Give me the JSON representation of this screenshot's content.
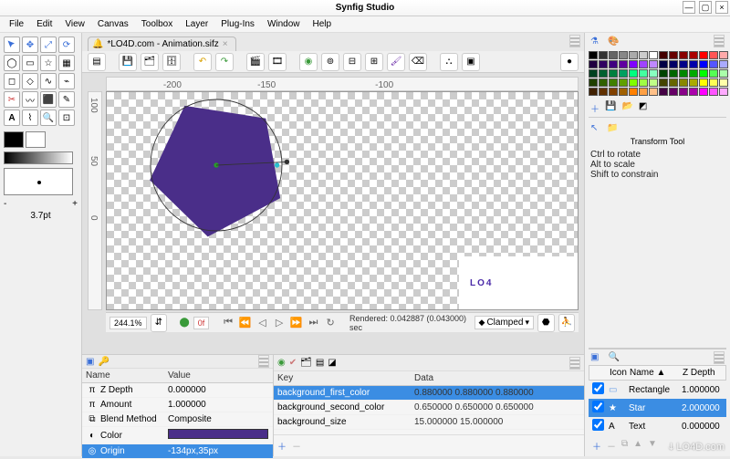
{
  "window": {
    "title": "Synfig Studio"
  },
  "menu": [
    "File",
    "Edit",
    "View",
    "Canvas",
    "Toolbox",
    "Layer",
    "Plug-Ins",
    "Window",
    "Help"
  ],
  "tab": {
    "label": "*LO4D.com - Animation.sifz"
  },
  "toolbox": {
    "stroke_adjust_minus": "-",
    "stroke_adjust_plus": "+",
    "stroke_pt": "3.7pt"
  },
  "ruler_h": {
    "m200": "-200",
    "m150": "-150",
    "m100": "-100"
  },
  "ruler_v": {
    "v100": "100",
    "v50": "50",
    "v0": "0"
  },
  "zoom": {
    "value": "244.1%"
  },
  "frame": {
    "value": "0f"
  },
  "render_status": "Rendered: 0.042887 (0.043000) sec",
  "interp": {
    "mode": "Clamped"
  },
  "watermark_text": "LO4",
  "site_watermark": "ↆ LO4D.com",
  "params_panel": {
    "headers": {
      "name": "Name",
      "value": "Value"
    },
    "rows": [
      {
        "icon": "π",
        "name": "Z Depth",
        "value": "0.000000"
      },
      {
        "icon": "π",
        "name": "Amount",
        "value": "1.000000"
      },
      {
        "icon": "⧉",
        "name": "Blend Method",
        "value": "Composite"
      },
      {
        "icon": "◐",
        "name": "Color",
        "value": "__COLOR__"
      },
      {
        "icon": "◎",
        "name": "Origin",
        "value": "-134px,35px"
      }
    ]
  },
  "metadata_panel": {
    "headers": {
      "key": "Key",
      "data": "Data"
    },
    "rows": [
      {
        "key": "background_first_color",
        "data": "0.880000 0.880000 0.880000"
      },
      {
        "key": "background_second_color",
        "data": "0.650000 0.650000 0.650000"
      },
      {
        "key": "background_size",
        "data": "15.000000 15.000000"
      }
    ]
  },
  "right": {
    "tool_title": "Transform Tool",
    "hints": [
      "Ctrl to rotate",
      "Alt to scale",
      "Shift to constrain"
    ],
    "palette": [
      "#000",
      "#333",
      "#666",
      "#888",
      "#aaa",
      "#ccc",
      "#fff",
      "#400",
      "#600",
      "#800",
      "#a00",
      "#f00",
      "#f55",
      "#faa",
      "#200040",
      "#300060",
      "#400080",
      "#6000a0",
      "#8000ff",
      "#a044ff",
      "#c088ff",
      "#004",
      "#006",
      "#008",
      "#00a",
      "#00f",
      "#55f",
      "#aaf",
      "#004020",
      "#006030",
      "#008040",
      "#00a060",
      "#00ff80",
      "#44ffa0",
      "#88ffc0",
      "#040",
      "#060",
      "#080",
      "#0a0",
      "#0f0",
      "#5f5",
      "#afa",
      "#204000",
      "#306000",
      "#408000",
      "#60a000",
      "#80ff00",
      "#a0ff44",
      "#c0ff88",
      "#440",
      "#660",
      "#880",
      "#aa0",
      "#ff0",
      "#ff5",
      "#ffa",
      "#402000",
      "#603000",
      "#804000",
      "#a06000",
      "#ff8000",
      "#ffa044",
      "#ffc088",
      "#404",
      "#606",
      "#808",
      "#a0a",
      "#f0f",
      "#f5f",
      "#faf"
    ],
    "layer_headers": {
      "icon": "Icon",
      "name": "Name ▲",
      "zdepth": "Z Depth"
    },
    "layers": [
      {
        "checked": true,
        "icon": "▭",
        "icon_color": "#6aa0e8",
        "name": "Rectangle",
        "z": "1.000000",
        "selected": false
      },
      {
        "checked": true,
        "icon": "★",
        "icon_color": "#fff",
        "name": "Star",
        "z": "2.000000",
        "selected": true
      },
      {
        "checked": true,
        "icon": "A",
        "icon_color": "#000",
        "name": "Text",
        "z": "0.000000",
        "selected": false
      }
    ]
  }
}
